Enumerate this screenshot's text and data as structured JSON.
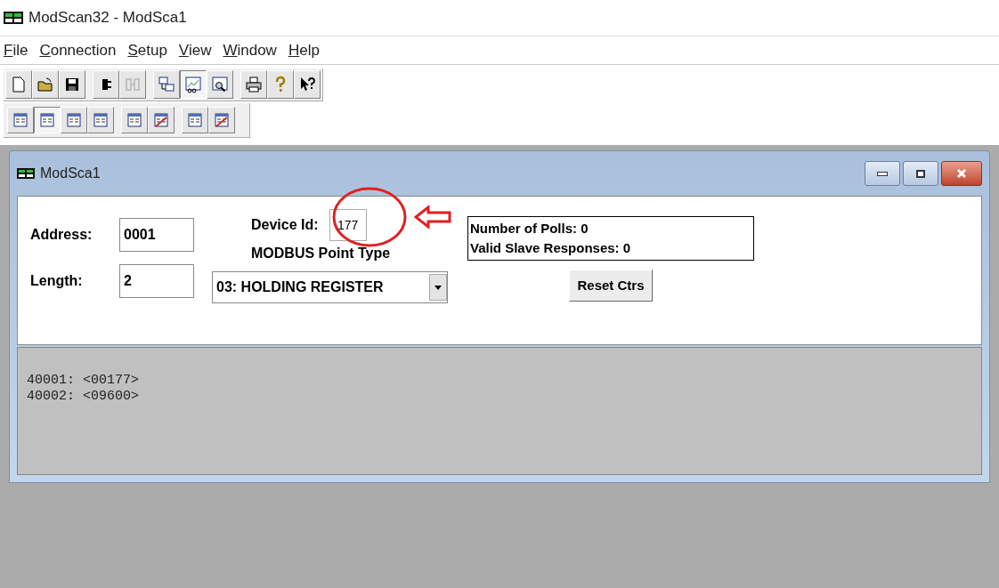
{
  "window": {
    "title": "ModScan32 - ModSca1"
  },
  "menu": [
    {
      "label": "File"
    },
    {
      "label": "Connection"
    },
    {
      "label": "Setup"
    },
    {
      "label": "View"
    },
    {
      "label": "Window"
    },
    {
      "label": "Help"
    }
  ],
  "toolbar": [
    [
      {
        "kind": "new",
        "pressed": false,
        "disabled": false
      },
      {
        "kind": "open",
        "pressed": false,
        "disabled": false
      },
      {
        "kind": "save",
        "pressed": false,
        "disabled": false
      }
    ],
    [
      {
        "kind": "connect",
        "pressed": false,
        "disabled": false
      },
      {
        "kind": "disconnect",
        "pressed": false,
        "disabled": true
      }
    ],
    [
      {
        "kind": "tree",
        "pressed": false,
        "disabled": false
      },
      {
        "kind": "chart",
        "pressed": true,
        "disabled": false
      },
      {
        "kind": "inspect",
        "pressed": false,
        "disabled": false
      }
    ],
    [
      {
        "kind": "print",
        "pressed": false,
        "disabled": false
      },
      {
        "kind": "help",
        "pressed": false,
        "disabled": false
      },
      {
        "kind": "context-help",
        "pressed": false,
        "disabled": false
      }
    ]
  ],
  "format_toolbar": [
    [
      {
        "kind": "binary",
        "pressed": false
      },
      {
        "kind": "decimal",
        "pressed": true
      },
      {
        "kind": "integer",
        "pressed": false
      },
      {
        "kind": "hex",
        "pressed": false
      }
    ],
    [
      {
        "kind": "float",
        "pressed": false
      },
      {
        "kind": "float-swapped",
        "pressed": false
      }
    ],
    [
      {
        "kind": "double",
        "pressed": false
      },
      {
        "kind": "double-swapped",
        "pressed": false
      }
    ]
  ],
  "child_window": {
    "title": "ModSca1",
    "device_id": {
      "label": "Device Id:",
      "value": "177"
    },
    "address": {
      "label": "Address:",
      "value": "0001"
    },
    "length": {
      "label": "Length:",
      "value": "2"
    },
    "point_type": {
      "label": "MODBUS Point Type",
      "value": "03: HOLDING REGISTER"
    },
    "counters": [
      "Number of Polls: 0",
      "Valid Slave Responses: 0"
    ],
    "reset_button": "Reset Ctrs",
    "registers": [
      "40001: <00177>",
      "40002: <09600>"
    ]
  }
}
